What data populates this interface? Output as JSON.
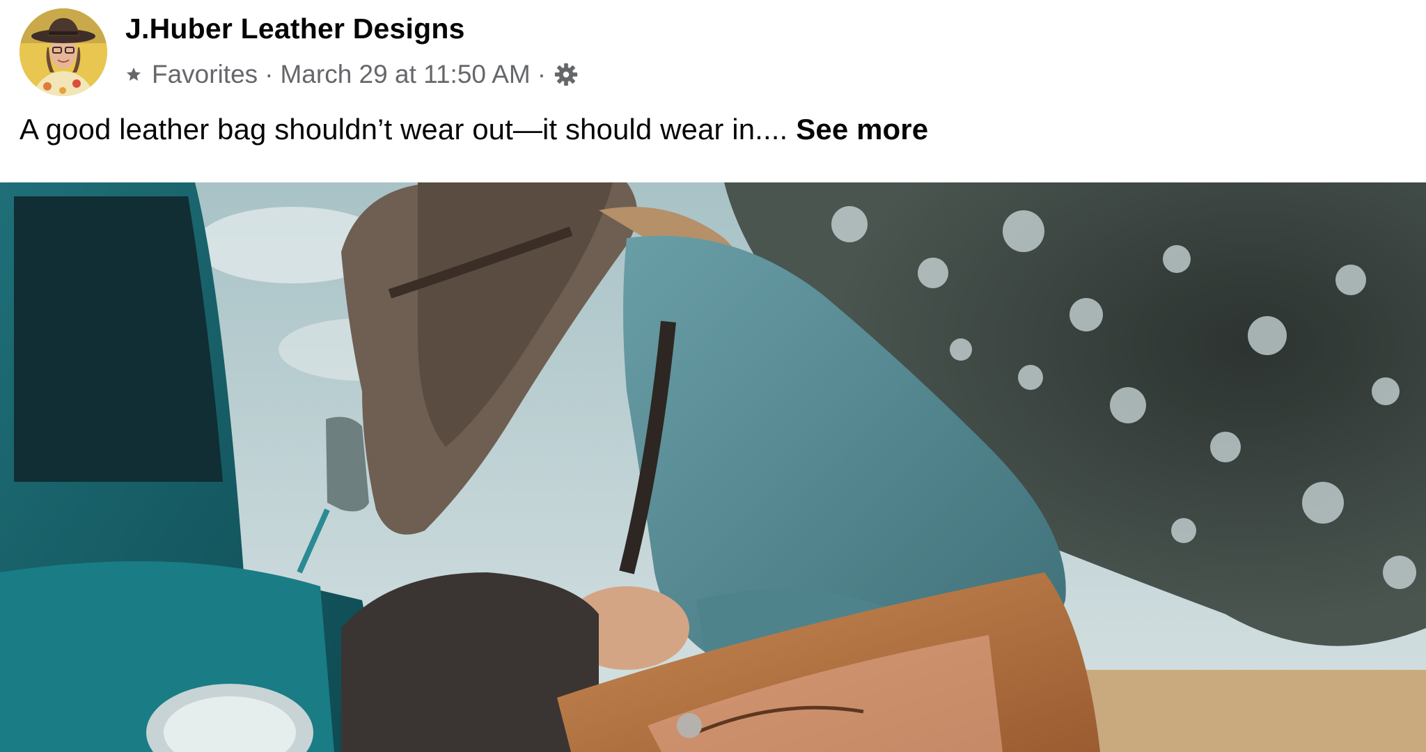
{
  "post": {
    "author": "J.Huber Leather Designs",
    "audience": "Favorites",
    "separator": "·",
    "timestamp": "March 29 at 11:50 AM",
    "caption": "A good leather bag shouldn’t wear out—it should wear in....",
    "see_more": "See more"
  },
  "icons": {
    "audience": "star-icon",
    "privacy": "gear-icon"
  },
  "colors": {
    "text_primary": "#050505",
    "text_secondary": "#65676b",
    "background": "#ffffff"
  }
}
